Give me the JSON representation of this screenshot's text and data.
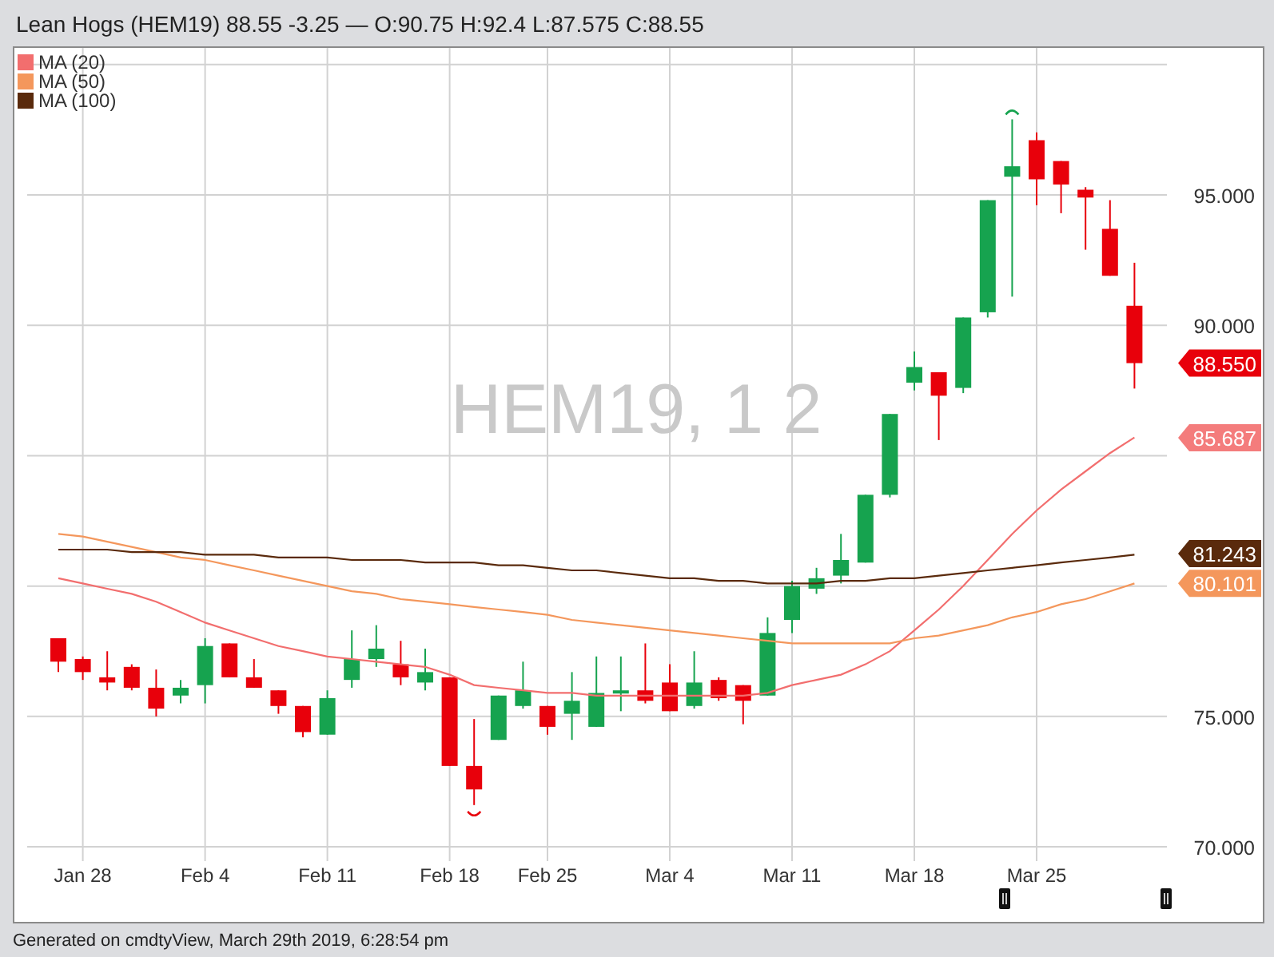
{
  "header": {
    "title": "Lean Hogs (HEM19) 88.55 -3.25 — O:90.75 H:92.4 L:87.575 C:88.55"
  },
  "symbol_overlay": "HEM19, 1 2",
  "chart_data": {
    "type": "candlestick",
    "categories": [
      null,
      "Jan 28",
      null,
      null,
      null,
      null,
      "Feb 4",
      null,
      null,
      null,
      null,
      "Feb 11",
      null,
      null,
      null,
      null,
      "Feb 18",
      null,
      null,
      null,
      "Feb 25",
      null,
      null,
      null,
      null,
      "Mar 4",
      null,
      null,
      null,
      null,
      "Mar 11",
      null,
      null,
      null,
      null,
      "Mar 18",
      null,
      null,
      null,
      null,
      "Mar 25",
      null,
      null,
      null,
      null
    ],
    "ylim": [
      69.45,
      100.7
    ],
    "grid": true,
    "yticks": [
      {
        "value": 70,
        "label": "70.000"
      },
      {
        "value": 75,
        "label": "75.000"
      },
      {
        "value": 90,
        "label": "90.000"
      },
      {
        "value": 95,
        "label": "95.000"
      }
    ],
    "ohlc": [
      [
        78.0,
        78.0,
        76.7,
        77.1
      ],
      [
        77.2,
        77.3,
        76.4,
        76.7
      ],
      [
        76.5,
        77.5,
        76.0,
        76.3
      ],
      [
        76.9,
        77.0,
        76.0,
        76.1
      ],
      [
        76.1,
        76.8,
        75.0,
        75.3
      ],
      [
        75.8,
        76.4,
        75.5,
        76.1
      ],
      [
        76.2,
        78.0,
        75.5,
        77.7
      ],
      [
        77.8,
        77.8,
        76.5,
        76.5
      ],
      [
        76.5,
        77.2,
        76.1,
        76.1
      ],
      [
        76.0,
        76.0,
        75.1,
        75.4
      ],
      [
        75.4,
        75.4,
        74.2,
        74.4
      ],
      [
        74.3,
        76.0,
        74.3,
        75.7
      ],
      [
        76.4,
        78.3,
        76.1,
        77.2
      ],
      [
        77.2,
        78.5,
        76.9,
        77.6
      ],
      [
        77.0,
        77.9,
        76.2,
        76.5
      ],
      [
        76.3,
        77.6,
        76.0,
        76.7
      ],
      [
        76.5,
        76.5,
        73.1,
        73.1
      ],
      [
        73.1,
        74.9,
        71.6,
        72.2
      ],
      [
        74.1,
        75.8,
        74.1,
        75.8
      ],
      [
        75.4,
        77.1,
        75.3,
        76.0
      ],
      [
        75.4,
        75.4,
        74.3,
        74.6
      ],
      [
        75.1,
        76.7,
        74.1,
        75.6
      ],
      [
        74.6,
        77.3,
        74.6,
        75.9
      ],
      [
        76.0,
        77.3,
        75.2,
        76.0
      ],
      [
        76.0,
        77.8,
        75.5,
        75.6
      ],
      [
        76.3,
        77.0,
        75.2,
        75.2
      ],
      [
        75.4,
        77.5,
        75.3,
        76.3
      ],
      [
        76.4,
        76.5,
        75.6,
        75.7
      ],
      [
        76.2,
        76.2,
        74.7,
        75.6
      ],
      [
        75.8,
        78.8,
        75.8,
        78.2
      ],
      [
        78.7,
        80.2,
        78.2,
        80.0
      ],
      [
        79.9,
        80.7,
        79.7,
        80.3
      ],
      [
        80.4,
        82.0,
        80.1,
        81.0
      ],
      [
        80.9,
        83.5,
        80.9,
        83.5
      ],
      [
        83.5,
        86.6,
        83.4,
        86.6
      ],
      [
        87.8,
        89.0,
        87.5,
        88.4
      ],
      [
        88.2,
        88.2,
        85.6,
        87.3
      ],
      [
        87.6,
        90.3,
        87.4,
        90.3
      ],
      [
        90.5,
        94.8,
        90.3,
        94.8
      ],
      [
        95.7,
        97.9,
        91.1,
        96.1
      ],
      [
        97.1,
        97.4,
        94.6,
        95.6
      ],
      [
        96.3,
        96.3,
        94.3,
        95.4
      ],
      [
        95.2,
        95.3,
        92.9,
        94.9
      ],
      [
        93.7,
        94.8,
        91.9,
        91.9
      ],
      [
        90.75,
        92.4,
        87.575,
        88.55
      ]
    ],
    "series": [
      {
        "name": "MA (20)",
        "type": "line",
        "color": "#f26e6e",
        "values": [
          80.3,
          80.1,
          79.9,
          79.7,
          79.4,
          79.0,
          78.6,
          78.3,
          78.0,
          77.7,
          77.5,
          77.3,
          77.2,
          77.1,
          77.0,
          76.9,
          76.6,
          76.2,
          76.1,
          76.0,
          75.9,
          75.9,
          75.8,
          75.8,
          75.8,
          75.8,
          75.8,
          75.8,
          75.8,
          75.9,
          76.2,
          76.4,
          76.6,
          77.0,
          77.5,
          78.3,
          79.1,
          80.0,
          81.0,
          82.0,
          82.9,
          83.7,
          84.4,
          85.1,
          85.7
        ]
      },
      {
        "name": "MA (50)",
        "type": "line",
        "color": "#f4975c",
        "values": [
          82.0,
          81.9,
          81.7,
          81.5,
          81.3,
          81.1,
          81.0,
          80.8,
          80.6,
          80.4,
          80.2,
          80.0,
          79.8,
          79.7,
          79.5,
          79.4,
          79.3,
          79.2,
          79.1,
          79.0,
          78.9,
          78.7,
          78.6,
          78.5,
          78.4,
          78.3,
          78.2,
          78.1,
          78.0,
          77.9,
          77.8,
          77.8,
          77.8,
          77.8,
          77.8,
          78.0,
          78.1,
          78.3,
          78.5,
          78.8,
          79.0,
          79.3,
          79.5,
          79.8,
          80.1
        ]
      },
      {
        "name": "MA (100)",
        "type": "line",
        "color": "#5a2a0c",
        "values": [
          81.4,
          81.4,
          81.4,
          81.3,
          81.3,
          81.3,
          81.2,
          81.2,
          81.2,
          81.1,
          81.1,
          81.1,
          81.0,
          81.0,
          81.0,
          80.9,
          80.9,
          80.9,
          80.8,
          80.8,
          80.7,
          80.6,
          80.6,
          80.5,
          80.4,
          80.3,
          80.3,
          80.2,
          80.2,
          80.1,
          80.1,
          80.1,
          80.2,
          80.2,
          80.3,
          80.3,
          80.4,
          80.5,
          80.6,
          80.7,
          80.8,
          80.9,
          81.0,
          81.1,
          81.2
        ]
      }
    ]
  },
  "price_tags": [
    {
      "value": "88.550",
      "color": "#e8000b"
    },
    {
      "value": "85.687",
      "color": "#f47c7c"
    },
    {
      "value": "81.243",
      "color": "#5a2a0c"
    },
    {
      "value": "80.101",
      "color": "#f4975c"
    }
  ],
  "footer": {
    "text": "Generated on cmdtyView, March 29th 2019, 6:28:54 pm"
  }
}
